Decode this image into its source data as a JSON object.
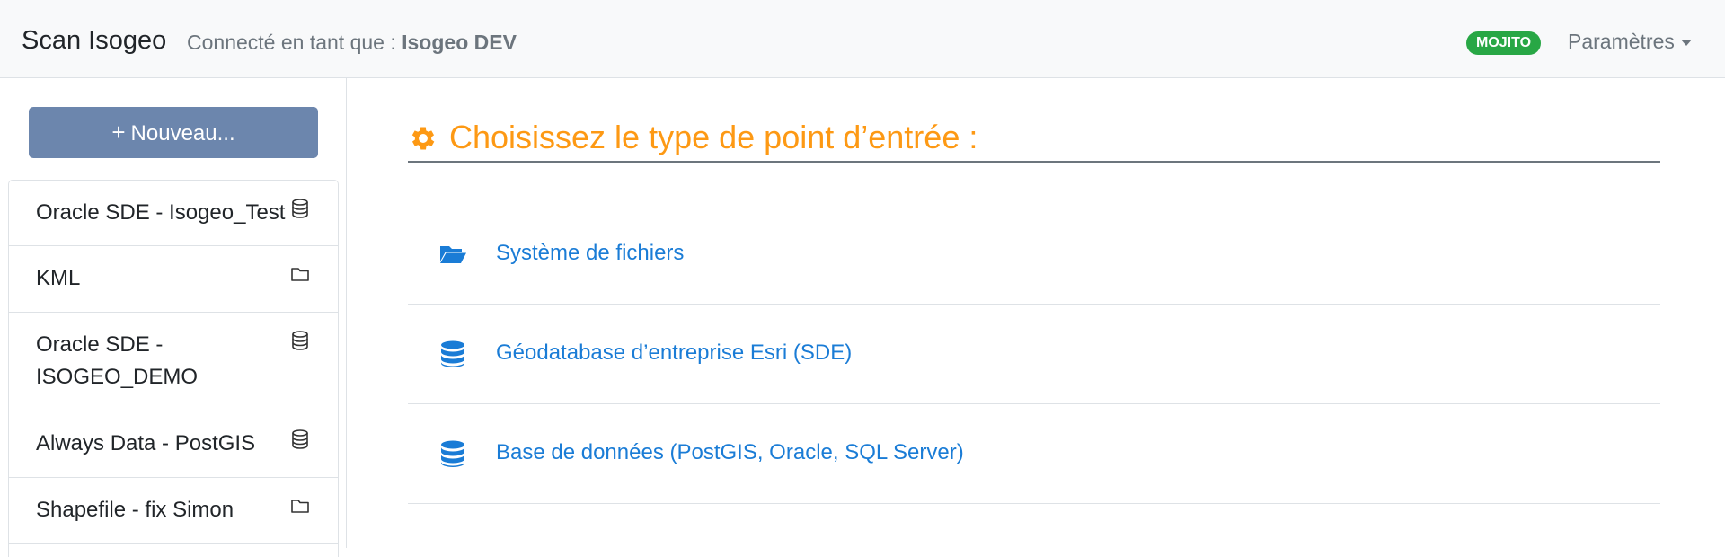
{
  "header": {
    "brand": "Scan Isogeo",
    "connected_prefix": "Connecté en tant que :",
    "user": "Isogeo DEV",
    "badge": "MOJITO",
    "settings_label": "Paramètres"
  },
  "sidebar": {
    "new_button_label": "Nouveau...",
    "items": [
      {
        "label": "Oracle SDE - Isogeo_Test",
        "icon": "database-icon"
      },
      {
        "label": "KML",
        "icon": "folder-icon"
      },
      {
        "label": "Oracle SDE - ISOGEO_DEMO",
        "icon": "database-icon"
      },
      {
        "label": "Always Data - PostGIS",
        "icon": "database-icon"
      },
      {
        "label": "Shapefile - fix Simon",
        "icon": "folder-icon"
      }
    ]
  },
  "main": {
    "heading": "Choisissez le type de point d’entrée :",
    "entries": [
      {
        "label": "Système de fichiers",
        "icon": "folder-open-icon"
      },
      {
        "label": "Géodatabase d’entreprise Esri (SDE)",
        "icon": "database-icon"
      },
      {
        "label": "Base de données (PostGIS, Oracle, SQL Server)",
        "icon": "database-icon"
      }
    ]
  },
  "colors": {
    "accent_orange": "#fd9914",
    "link_blue": "#1a7cd6",
    "badge_green": "#28a745",
    "button_blue": "#6c86ad"
  }
}
